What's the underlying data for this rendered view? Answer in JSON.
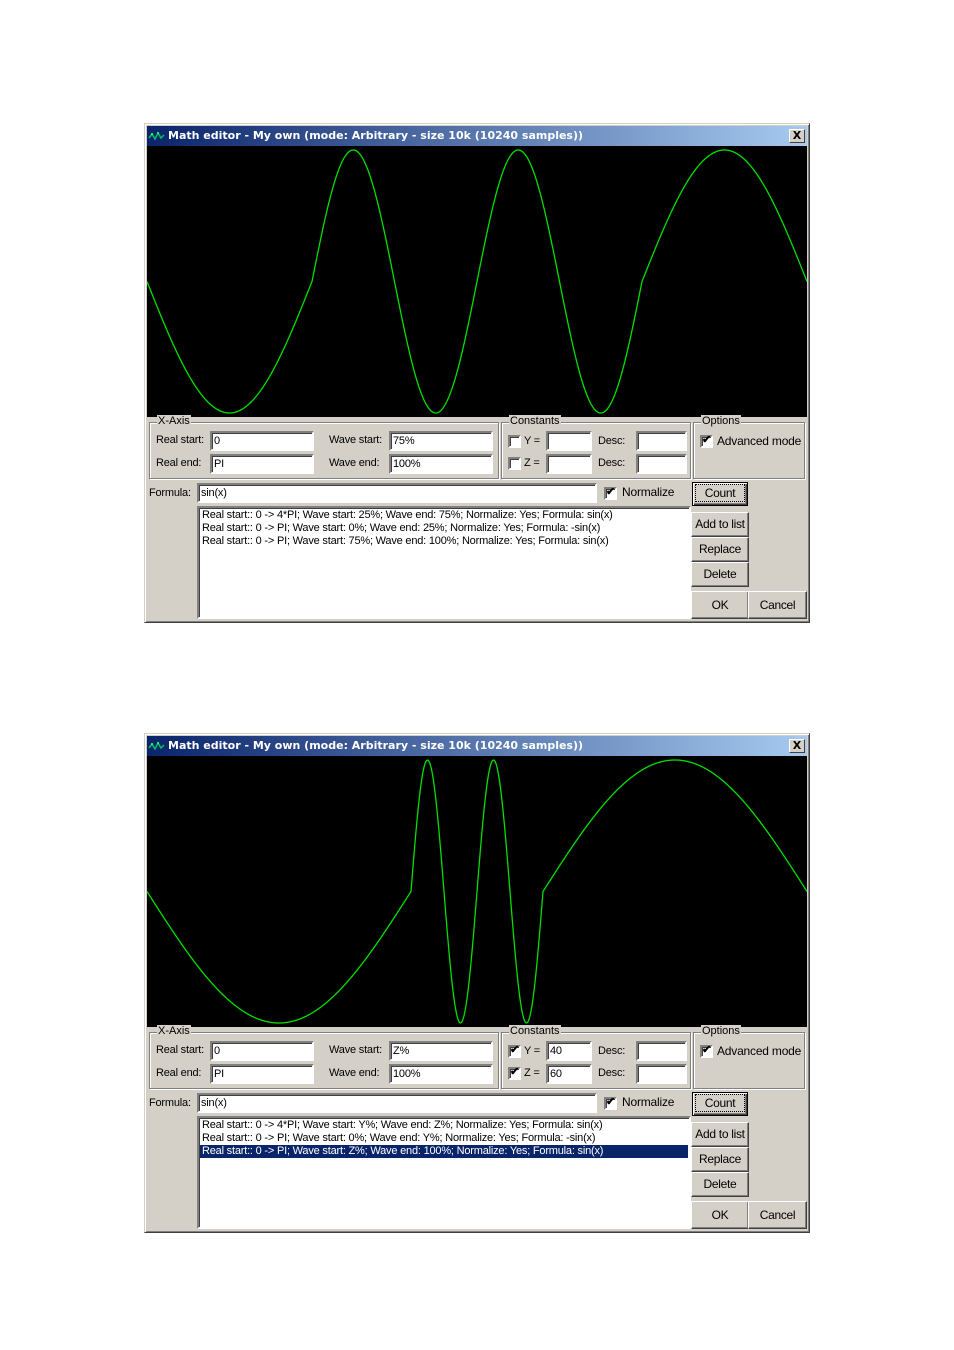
{
  "colors": {
    "trace": "#00e000",
    "plot_bg": "#000000",
    "titlebar_start": "#0a246a",
    "titlebar_end": "#a6caf0",
    "dialog_bg": "#d4d0c8",
    "selection": "#0a246a"
  },
  "dialogs": [
    {
      "title": "Math editor - My own (mode: Arbitrary - size 10k (10240 samples))",
      "close_label": "X",
      "xaxis": {
        "legend": "X-Axis",
        "real_start_label": "Real start:",
        "real_start_value": "0",
        "real_end_label": "Real end:",
        "real_end_value": "PI",
        "wave_start_label": "Wave start:",
        "wave_start_value": "75%",
        "wave_end_label": "Wave end:",
        "wave_end_value": "100%"
      },
      "constants": {
        "legend": "Constants",
        "y_checked": false,
        "y_label": "Y =",
        "y_value": "",
        "y_desc_label": "Desc:",
        "y_desc_value": "",
        "z_checked": false,
        "z_label": "Z =",
        "z_value": "",
        "z_desc_label": "Desc:",
        "z_desc_value": ""
      },
      "options": {
        "legend": "Options",
        "advanced_mode_label": "Advanced mode",
        "advanced_mode_checked": true
      },
      "formula": {
        "label": "Formula:",
        "value": "sin(x)",
        "normalize_label": "Normalize",
        "normalize_checked": true
      },
      "buttons": {
        "count": "Count",
        "add_to_list": "Add to list",
        "replace": "Replace",
        "delete": "Delete",
        "ok": "OK",
        "cancel": "Cancel"
      },
      "list": [
        {
          "text": "Real start:: 0 -> 4*PI; Wave start: 25%; Wave end: 75%; Normalize: Yes; Formula: sin(x)",
          "selected": false
        },
        {
          "text": "Real start:: 0 -> PI; Wave start: 0%; Wave end: 25%; Normalize: Yes; Formula: -sin(x)",
          "selected": false
        },
        {
          "text": "Real start:: 0 -> PI; Wave start: 75%; Wave end: 100%; Normalize: Yes; Formula: sin(x)",
          "selected": false
        }
      ],
      "waveform": {
        "segments": [
          {
            "formula": "-sin(x)",
            "real_start": 0,
            "real_end": 3.14159,
            "wave_start_pct": 0,
            "wave_end_pct": 25
          },
          {
            "formula": "sin(x)",
            "real_start": 0,
            "real_end": 12.56637,
            "wave_start_pct": 25,
            "wave_end_pct": 75
          },
          {
            "formula": "sin(x)",
            "real_start": 0,
            "real_end": 3.14159,
            "wave_start_pct": 75,
            "wave_end_pct": 100
          }
        ]
      }
    },
    {
      "title": "Math editor - My own (mode: Arbitrary - size 10k (10240 samples))",
      "close_label": "X",
      "xaxis": {
        "legend": "X-Axis",
        "real_start_label": "Real start:",
        "real_start_value": "0",
        "real_end_label": "Real end:",
        "real_end_value": "PI",
        "wave_start_label": "Wave start:",
        "wave_start_value": "Z%",
        "wave_end_label": "Wave end:",
        "wave_end_value": "100%"
      },
      "constants": {
        "legend": "Constants",
        "y_checked": true,
        "y_label": "Y =",
        "y_value": "40",
        "y_desc_label": "Desc:",
        "y_desc_value": "",
        "z_checked": true,
        "z_label": "Z =",
        "z_value": "60",
        "z_desc_label": "Desc:",
        "z_desc_value": ""
      },
      "options": {
        "legend": "Options",
        "advanced_mode_label": "Advanced mode",
        "advanced_mode_checked": true
      },
      "formula": {
        "label": "Formula:",
        "value": "sin(x)",
        "normalize_label": "Normalize",
        "normalize_checked": true
      },
      "buttons": {
        "count": "Count",
        "add_to_list": "Add to list",
        "replace": "Replace",
        "delete": "Delete",
        "ok": "OK",
        "cancel": "Cancel"
      },
      "list": [
        {
          "text": "Real start:: 0 -> 4*PI; Wave start: Y%; Wave end: Z%; Normalize: Yes; Formula: sin(x)",
          "selected": false
        },
        {
          "text": "Real start:: 0 -> PI; Wave start: 0%; Wave end: Y%; Normalize: Yes; Formula: -sin(x)",
          "selected": false
        },
        {
          "text": "Real start:: 0 -> PI; Wave start: Z%; Wave end: 100%; Normalize: Yes; Formula: sin(x)",
          "selected": true
        }
      ],
      "waveform": {
        "segments": [
          {
            "formula": "-sin(x)",
            "real_start": 0,
            "real_end": 3.14159,
            "wave_start_pct": 0,
            "wave_end_pct": 40
          },
          {
            "formula": "sin(x)",
            "real_start": 0,
            "real_end": 12.56637,
            "wave_start_pct": 40,
            "wave_end_pct": 60
          },
          {
            "formula": "sin(x)",
            "real_start": 0,
            "real_end": 3.14159,
            "wave_start_pct": 60,
            "wave_end_pct": 100
          }
        ]
      }
    }
  ]
}
